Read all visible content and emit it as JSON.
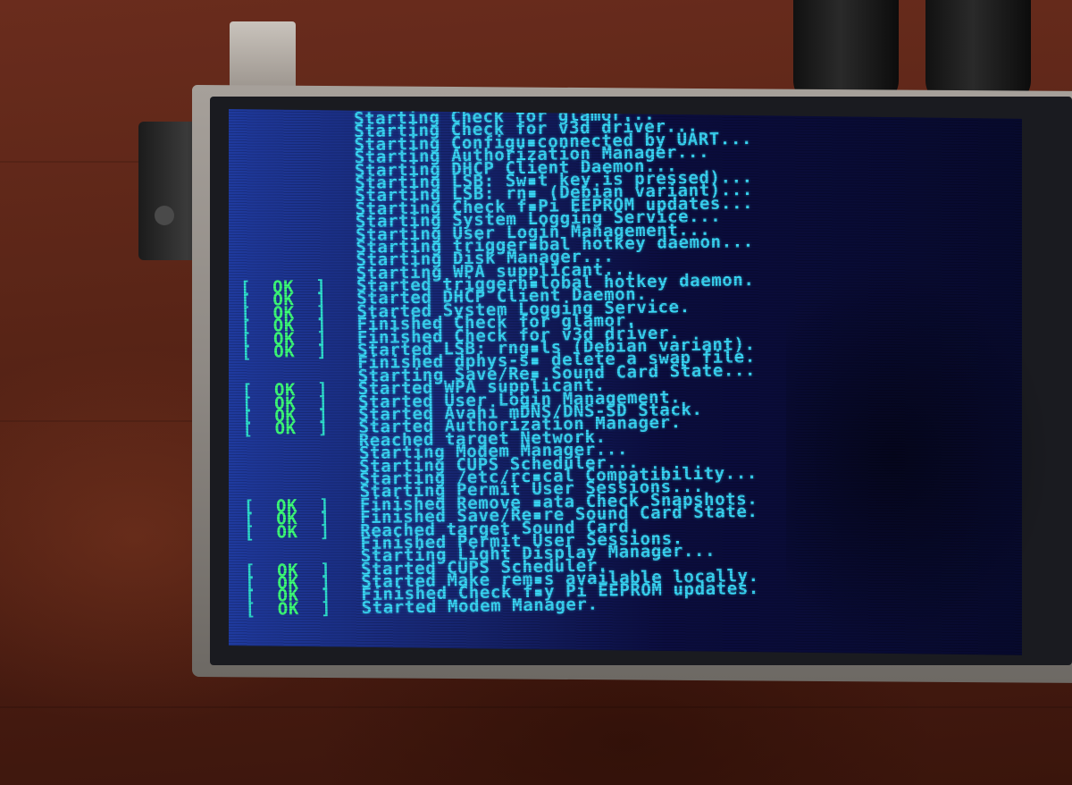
{
  "boot_log": [
    {
      "status": "",
      "text": "Starting Check for glamor..."
    },
    {
      "status": "",
      "text": "Starting Check for v3d driver..."
    },
    {
      "status": "",
      "text": "Starting Configu▪connected by UART..."
    },
    {
      "status": "",
      "text": "Starting Authorization Manager..."
    },
    {
      "status": "",
      "text": "Starting DHCP Client Daemon..."
    },
    {
      "status": "",
      "text": "Starting LSB: Sw▪t key is pressed)..."
    },
    {
      "status": "",
      "text": "Starting LSB: rn▪ (Debian variant)..."
    },
    {
      "status": "",
      "text": "Starting Check f▪Pi EEPROM updates..."
    },
    {
      "status": "",
      "text": "Starting System Logging Service..."
    },
    {
      "status": "",
      "text": "Starting User Login Management..."
    },
    {
      "status": "",
      "text": "Starting trigger▪bal hotkey daemon..."
    },
    {
      "status": "",
      "text": "Starting Disk Manager..."
    },
    {
      "status": "",
      "text": "Starting WPA supplicant..."
    },
    {
      "status": "OK",
      "text": "Started triggerh▪lobal hotkey daemon."
    },
    {
      "status": "OK",
      "text": "Started DHCP Client Daemon."
    },
    {
      "status": "OK",
      "text": "Started System Logging Service."
    },
    {
      "status": "OK",
      "text": "Finished Check for glamor."
    },
    {
      "status": "OK",
      "text": "Finished Check for v3d driver."
    },
    {
      "status": "OK",
      "text": "Started LSB: rng▪ls (Debian variant)."
    },
    {
      "status": "",
      "text": "Finished dphys-s▪ delete a swap file."
    },
    {
      "status": "",
      "text": "Starting Save/Re▪ Sound Card State..."
    },
    {
      "status": "OK",
      "text": "Started WPA supplicant."
    },
    {
      "status": "OK",
      "text": "Started User Login Management."
    },
    {
      "status": "OK",
      "text": "Started Avahi mDNS/DNS-SD Stack."
    },
    {
      "status": "OK",
      "text": "Started Authorization Manager."
    },
    {
      "status": "",
      "text": "Reached target Network."
    },
    {
      "status": "",
      "text": "Starting Modem Manager..."
    },
    {
      "status": "",
      "text": "Starting CUPS Scheduler..."
    },
    {
      "status": "",
      "text": "Starting /etc/rc▪cal Compatibility..."
    },
    {
      "status": "",
      "text": "Starting Permit User Sessions..."
    },
    {
      "status": "OK",
      "text": "Finished Remove ▪ata Check Snapshots."
    },
    {
      "status": "OK",
      "text": "Finished Save/Re▪re Sound Card State."
    },
    {
      "status": "OK",
      "text": "Reached target Sound Card."
    },
    {
      "status": "",
      "text": "Finished Permit User Sessions."
    },
    {
      "status": "",
      "text": "Starting Light Display Manager..."
    },
    {
      "status": "OK",
      "text": "Started CUPS Scheduler."
    },
    {
      "status": "OK",
      "text": "Started Make rem▪s available locally."
    },
    {
      "status": "OK",
      "text": "Finished Check f▪y Pi EEPROM updates."
    },
    {
      "status": "OK",
      "text": "Started Modem Manager."
    }
  ],
  "colors": {
    "ok_green": "#3dff7a",
    "bracket_cyan": "#2ee0d0",
    "message_cyan": "#39d6f6",
    "screen_blue": "#1f3a9e"
  }
}
